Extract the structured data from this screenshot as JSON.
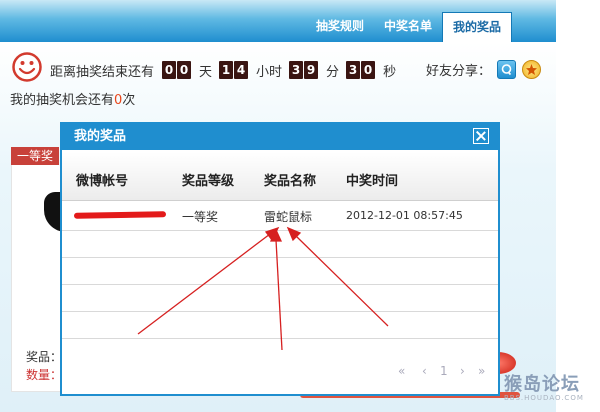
{
  "tabs": [
    {
      "label": "抽奖规则",
      "active": false
    },
    {
      "label": "中奖名单",
      "active": false
    },
    {
      "label": "我的奖品",
      "active": true
    }
  ],
  "countdown": {
    "prefix": "距离抽奖结束还有",
    "days": [
      "0",
      "0"
    ],
    "day_unit": "天",
    "hours": [
      "1",
      "4"
    ],
    "hour_unit": "小时",
    "minutes": [
      "3",
      "9"
    ],
    "minute_unit": "分",
    "seconds": [
      "3",
      "0"
    ],
    "second_unit": "秒"
  },
  "share": {
    "label": "好友分享："
  },
  "chances": {
    "prefix": "我的抽奖机会还有",
    "count": "0",
    "suffix": "次"
  },
  "prize_tag": "一等奖",
  "bottom": {
    "prize_label": "奖品：",
    "qty_label": "数量："
  },
  "modal": {
    "title": "我的奖品",
    "columns": [
      "微博帐号",
      "奖品等级",
      "奖品名称",
      "中奖时间"
    ],
    "rows": [
      {
        "account": "",
        "level": "一等奖",
        "name": "雷蛇鼠标",
        "time": "2012-12-01 08:57:45"
      }
    ],
    "pager": {
      "first": "«",
      "prev": "‹",
      "current": "1",
      "next": "›",
      "last": "»"
    }
  },
  "watermark": {
    "title": "猴岛论坛",
    "url": "BBS.HOUDAO.COM"
  },
  "colors": {
    "brand_blue": "#1f8ecf",
    "accent_red": "#c8413a",
    "digit_bg": "#3a1512",
    "highlight": "#e8461b"
  }
}
